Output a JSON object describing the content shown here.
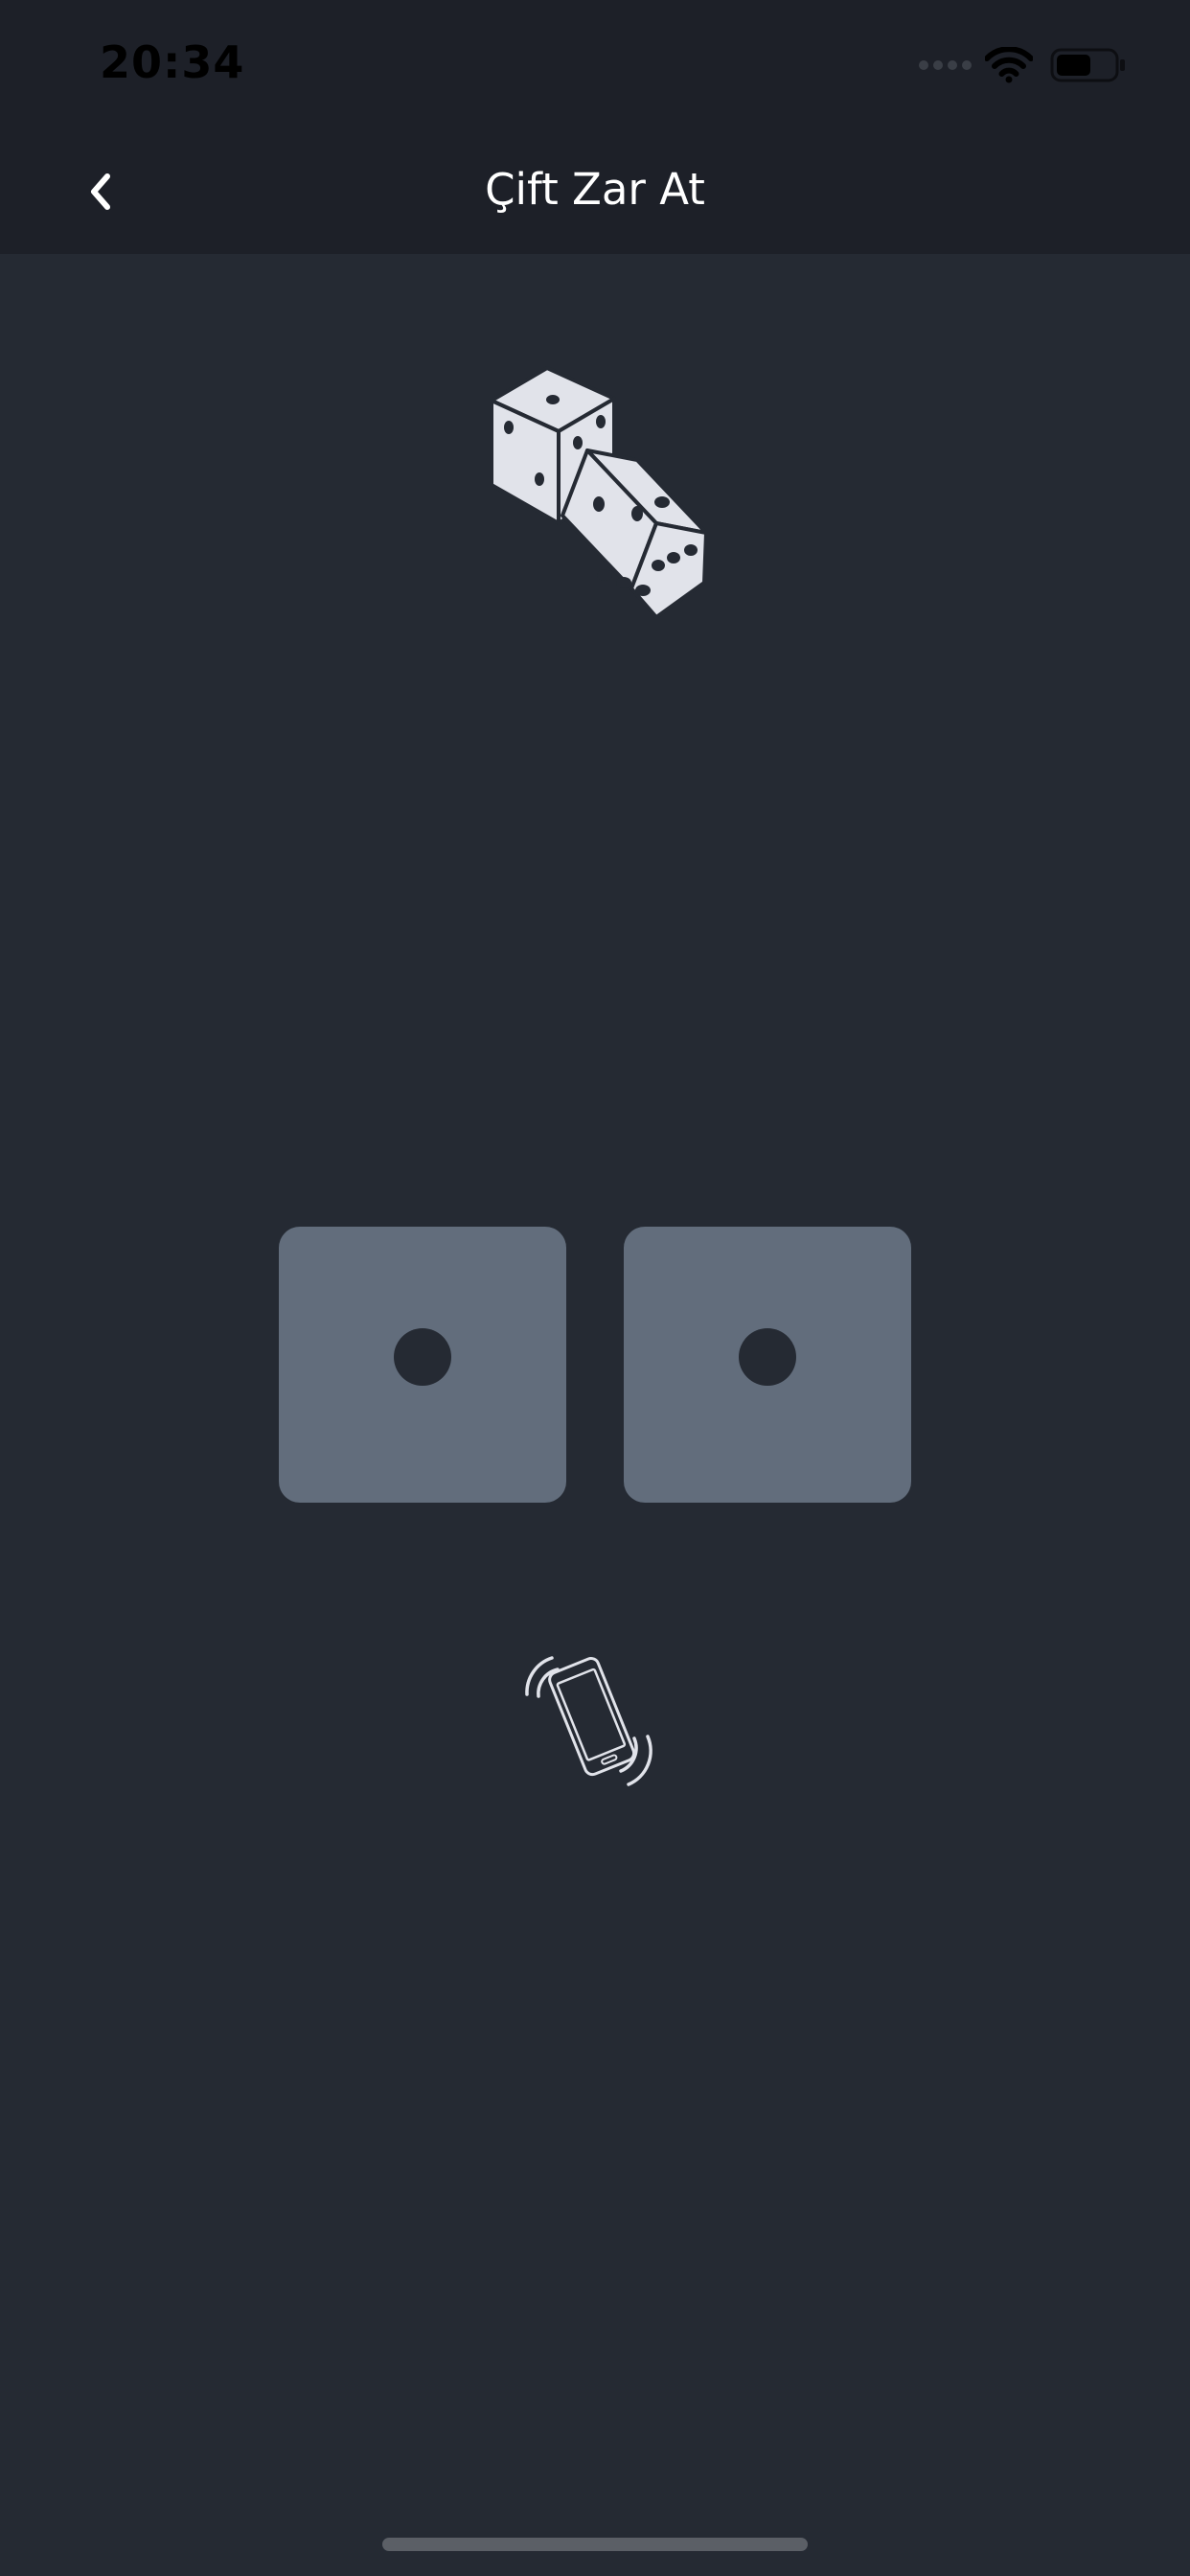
{
  "status_bar": {
    "time": "20:34",
    "icons": [
      "cellular-signal-icon",
      "wifi-icon",
      "battery-icon"
    ],
    "battery_level": 0.6
  },
  "nav": {
    "back_icon": "chevron-left-icon",
    "title": "Çift Zar At"
  },
  "dice_logo": {
    "icon": "dice-pair-icon"
  },
  "dice": [
    {
      "value": 1
    },
    {
      "value": 1
    }
  ],
  "shake_hint": {
    "icon": "shake-phone-icon"
  },
  "colors": {
    "background": "#252a33",
    "header": "#1d2028",
    "die_face": "#626d7c",
    "pip": "#252a33",
    "icon_light": "#e1e3ea"
  }
}
